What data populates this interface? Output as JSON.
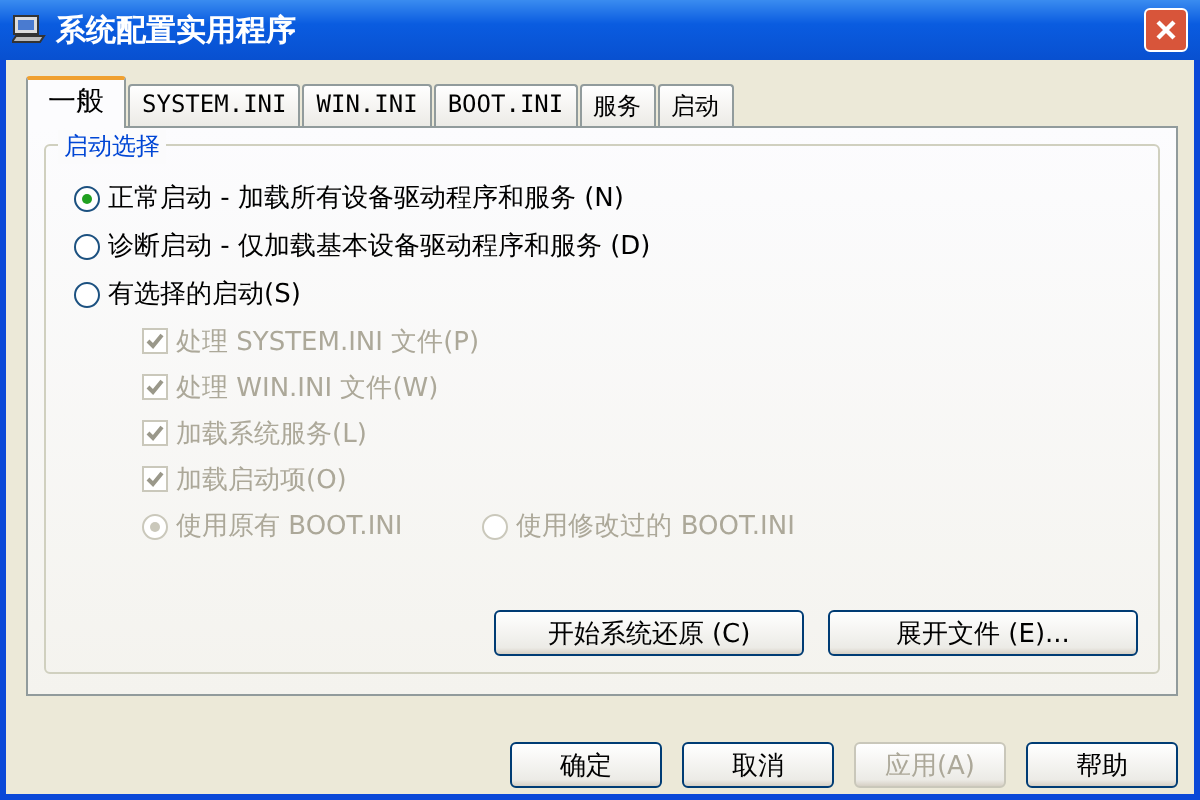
{
  "window": {
    "title": "系统配置实用程序"
  },
  "tabs": [
    {
      "label": "一般",
      "selected": true
    },
    {
      "label": "SYSTEM.INI",
      "selected": false
    },
    {
      "label": "WIN.INI",
      "selected": false
    },
    {
      "label": "BOOT.INI",
      "selected": false
    },
    {
      "label": "服务",
      "selected": false
    },
    {
      "label": "启动",
      "selected": false
    }
  ],
  "group": {
    "title": "启动选择"
  },
  "startup_modes": [
    {
      "label": "正常启动 - 加载所有设备驱动程序和服务 (N)",
      "selected": true
    },
    {
      "label": "诊断启动 - 仅加载基本设备驱动程序和服务 (D)",
      "selected": false
    },
    {
      "label": "有选择的启动(S)",
      "selected": false
    }
  ],
  "selective_options": [
    {
      "label": "处理 SYSTEM.INI 文件(P)",
      "checked": true,
      "disabled": true
    },
    {
      "label": "处理 WIN.INI 文件(W)",
      "checked": true,
      "disabled": true
    },
    {
      "label": "加载系统服务(L)",
      "checked": true,
      "disabled": true
    },
    {
      "label": "加载启动项(O)",
      "checked": true,
      "disabled": true
    }
  ],
  "boot_ini_options": [
    {
      "label": "使用原有 BOOT.INI",
      "selected": true,
      "disabled": true
    },
    {
      "label": "使用修改过的 BOOT.INI",
      "selected": false,
      "disabled": true
    }
  ],
  "panel_buttons": [
    {
      "label": "开始系统还原 (C)"
    },
    {
      "label": "展开文件 (E)..."
    }
  ],
  "dialog_buttons": [
    {
      "label": "确定",
      "disabled": false
    },
    {
      "label": "取消",
      "disabled": false
    },
    {
      "label": "应用(A)",
      "disabled": true
    },
    {
      "label": "帮助",
      "disabled": false
    }
  ]
}
